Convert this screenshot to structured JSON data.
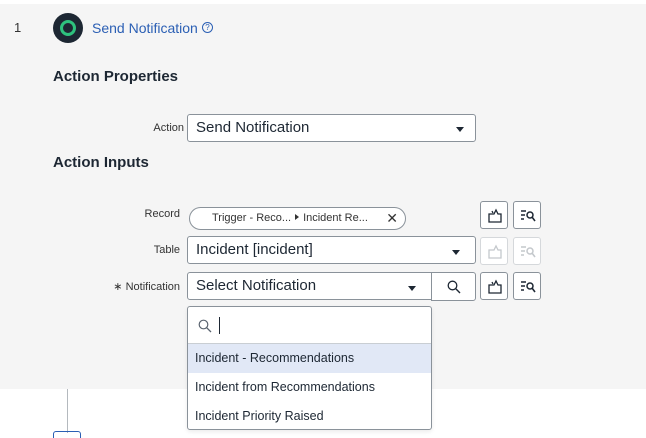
{
  "step": {
    "number": "1",
    "title": "Send Notification",
    "help_icon": "help-circle-icon"
  },
  "action_properties": {
    "heading": "Action Properties",
    "action_label": "Action",
    "action_value": "Send Notification"
  },
  "action_inputs": {
    "heading": "Action Inputs",
    "record": {
      "label": "Record",
      "pill_part1": "Trigger - Reco...",
      "pill_part2": "Incident Re...",
      "clear_icon": "close-icon"
    },
    "table": {
      "label": "Table",
      "value": "Incident [incident]"
    },
    "notification": {
      "required_mark": "∗",
      "label": "Notification",
      "value": "Select Notification"
    }
  },
  "dropdown": {
    "search_value": "",
    "options": [
      "Incident - Recommendations",
      "Incident from Recommendations",
      "Incident Priority Raised"
    ],
    "highlighted_index": 0
  },
  "colors": {
    "link_blue": "#2b5fb4",
    "highlight": "#e1e8f6",
    "panel_bg": "#f5f5f5"
  }
}
